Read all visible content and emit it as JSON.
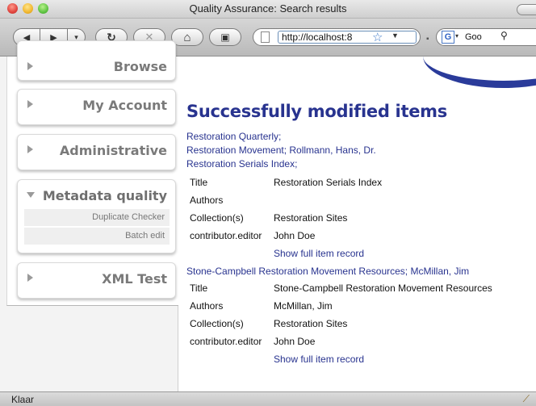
{
  "window": {
    "title": "Quality Assurance: Search results"
  },
  "toolbar": {
    "back_icon": "◀",
    "forward_icon": "▶",
    "history_icon": "▾",
    "reload_icon": "↻",
    "stop_icon": "✕",
    "home_icon": "⌂",
    "bookmark_icon": "▣",
    "url": "http://localhost:8",
    "url_dropdown_icon": "▼",
    "bookmark_star": "☆",
    "search_engine_letter": "G",
    "search_value": "Goo",
    "search_icon": "🔍"
  },
  "sidebar": {
    "items": [
      {
        "label": "Browse"
      },
      {
        "label": "My Account"
      },
      {
        "label": "Administrative"
      },
      {
        "label": "Metadata quality",
        "subitems": [
          "Duplicate Checker",
          "Batch edit"
        ]
      },
      {
        "label": "XML Test"
      }
    ]
  },
  "main": {
    "title": "Successfully modified items",
    "results": [
      {
        "links": [
          "Restoration Quarterly;",
          "Restoration Movement; Rollmann, Hans, Dr.",
          "Restoration Serials Index;"
        ],
        "fields": [
          {
            "name": "Title",
            "value": "Restoration Serials Index"
          },
          {
            "name": "Authors",
            "value": ""
          },
          {
            "name": "Collection(s)",
            "value": "Restoration Sites"
          },
          {
            "name": "contributor.editor",
            "value": "John Doe"
          }
        ],
        "show_full": "Show full item record"
      },
      {
        "links": [
          "Stone-Campbell Restoration Movement Resources; McMillan, Jim"
        ],
        "fields": [
          {
            "name": "Title",
            "value": "Stone-Campbell Restoration Movement Resources"
          },
          {
            "name": "Authors",
            "value": "McMillan, Jim"
          },
          {
            "name": "Collection(s)",
            "value": "Restoration Sites"
          },
          {
            "name": "contributor.editor",
            "value": "John Doe"
          }
        ],
        "show_full": "Show full item record"
      }
    ]
  },
  "status": {
    "text": "Klaar"
  },
  "colors": {
    "heading": "#28338f",
    "link": "#28338f",
    "sidebar_label": "#7a7a7a"
  }
}
